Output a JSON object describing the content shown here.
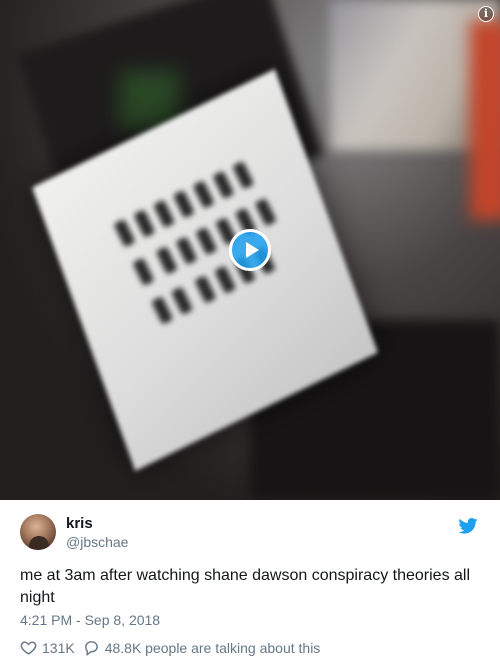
{
  "media": {
    "play_icon": "play-icon",
    "info_icon": "info-icon",
    "info_glyph": "i"
  },
  "tweet": {
    "name": "kris",
    "handle": "@jbschae",
    "text": "me at 3am after watching shane dawson conspiracy theories all night",
    "timestamp": "4:21 PM - Sep 8, 2018",
    "likes": "131K",
    "conversation": "48.8K people are talking about this"
  },
  "colors": {
    "twitter_blue": "#1da1f2",
    "secondary_text": "#657786"
  }
}
